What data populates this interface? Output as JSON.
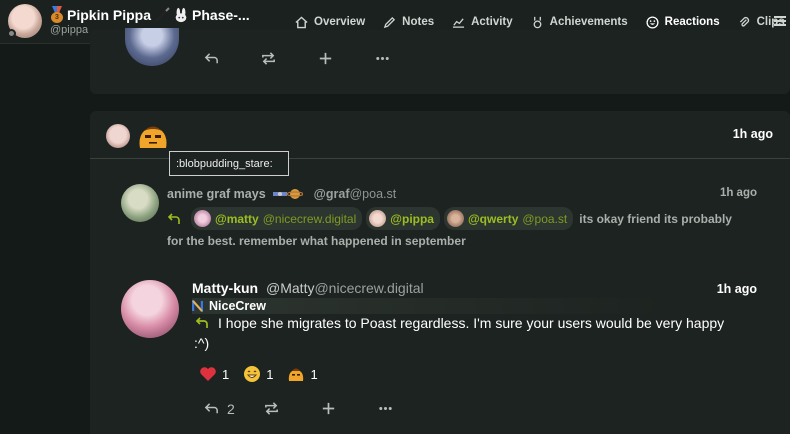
{
  "header": {
    "display_name": "Pipkin Pippa",
    "name_suffix": "Phase-...",
    "handle": "@pippa",
    "medal_number": "3",
    "nav": [
      {
        "label": "Overview",
        "icon": "home-icon"
      },
      {
        "label": "Notes",
        "icon": "pencil-icon"
      },
      {
        "label": "Activity",
        "icon": "chart-icon"
      },
      {
        "label": "Achievements",
        "icon": "medal-icon"
      },
      {
        "label": "Reactions",
        "icon": "smile-icon",
        "active": true
      },
      {
        "label": "Clips",
        "icon": "paperclip-icon"
      }
    ]
  },
  "notification": {
    "time": "1h ago",
    "tooltip": ":blobpudding_stare:"
  },
  "quoted_note": {
    "author": "anime graf mays",
    "handle_user": "@graf",
    "handle_host": "@poa.st",
    "time": "1h ago",
    "mentions": [
      {
        "user": "@matty",
        "host": "@nicecrew.digital"
      },
      {
        "user": "@pippa",
        "host": ""
      },
      {
        "user": "@qwerty",
        "host": "@poa.st"
      }
    ],
    "text_line1": "its okay friend its probably",
    "text_line2": "for the best. remember what happened in september"
  },
  "note": {
    "author": "Matty-kun",
    "handle_user": "@Matty",
    "handle_host": "@nicecrew.digital",
    "time": "1h ago",
    "instance": "NiceCrew",
    "text_line1": "I hope she migrates to Poast regardless. I'm sure your users would be very happy",
    "text_line2": ":^)",
    "reactions": [
      {
        "icon": "heart-icon",
        "count": "1"
      },
      {
        "icon": "grin-icon",
        "count": "1"
      },
      {
        "icon": "blobpudding-icon",
        "count": "1"
      }
    ],
    "reply_count": "2"
  },
  "colors": {
    "accent": "#c2dd2c",
    "mention": "#9cbf1f",
    "background": "#141a17",
    "card": "#1d2320"
  }
}
